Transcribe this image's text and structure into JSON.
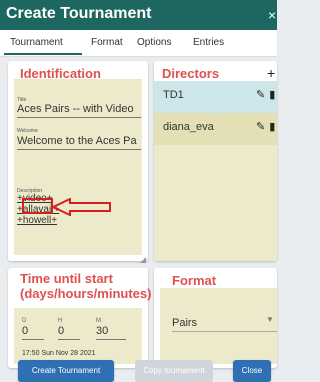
{
  "dialog": {
    "title": "Create Tournament",
    "close_symbol": "×"
  },
  "tabs": [
    "Tournament",
    "Format",
    "Options",
    "Entries"
  ],
  "identification": {
    "title": "Identification",
    "title_label": "Title",
    "title_value": "Aces Pairs -- with Video",
    "welcome_label": "Welcome",
    "welcome_value": "Welcome to the Aces Pa",
    "description_label": "Description",
    "description_lines": [
      "+video+",
      "+allavail+",
      "+howell+"
    ]
  },
  "directors": {
    "title": "Directors",
    "add_symbol": "+",
    "items": [
      {
        "name": "TD1"
      },
      {
        "name": "diana_eva"
      }
    ]
  },
  "time_until_start": {
    "title_line1": "Time until start",
    "title_line2": "(days/hours/minutes)",
    "days_label": "D",
    "days_value": "0",
    "hours_label": "H",
    "hours_value": "0",
    "minutes_label": "M",
    "minutes_value": "30",
    "start_datetime": "17:50 Sun Nov 28 2021"
  },
  "format": {
    "title": "Format",
    "selected": "Pairs"
  },
  "buttons": {
    "create": "Create Tournament",
    "copy": "Copy tournament",
    "close": "Close"
  },
  "colors": {
    "header": "#1e6760",
    "accent_red": "#e05050",
    "button_blue": "#2f6fb3",
    "field_bg": "#eceacb"
  }
}
